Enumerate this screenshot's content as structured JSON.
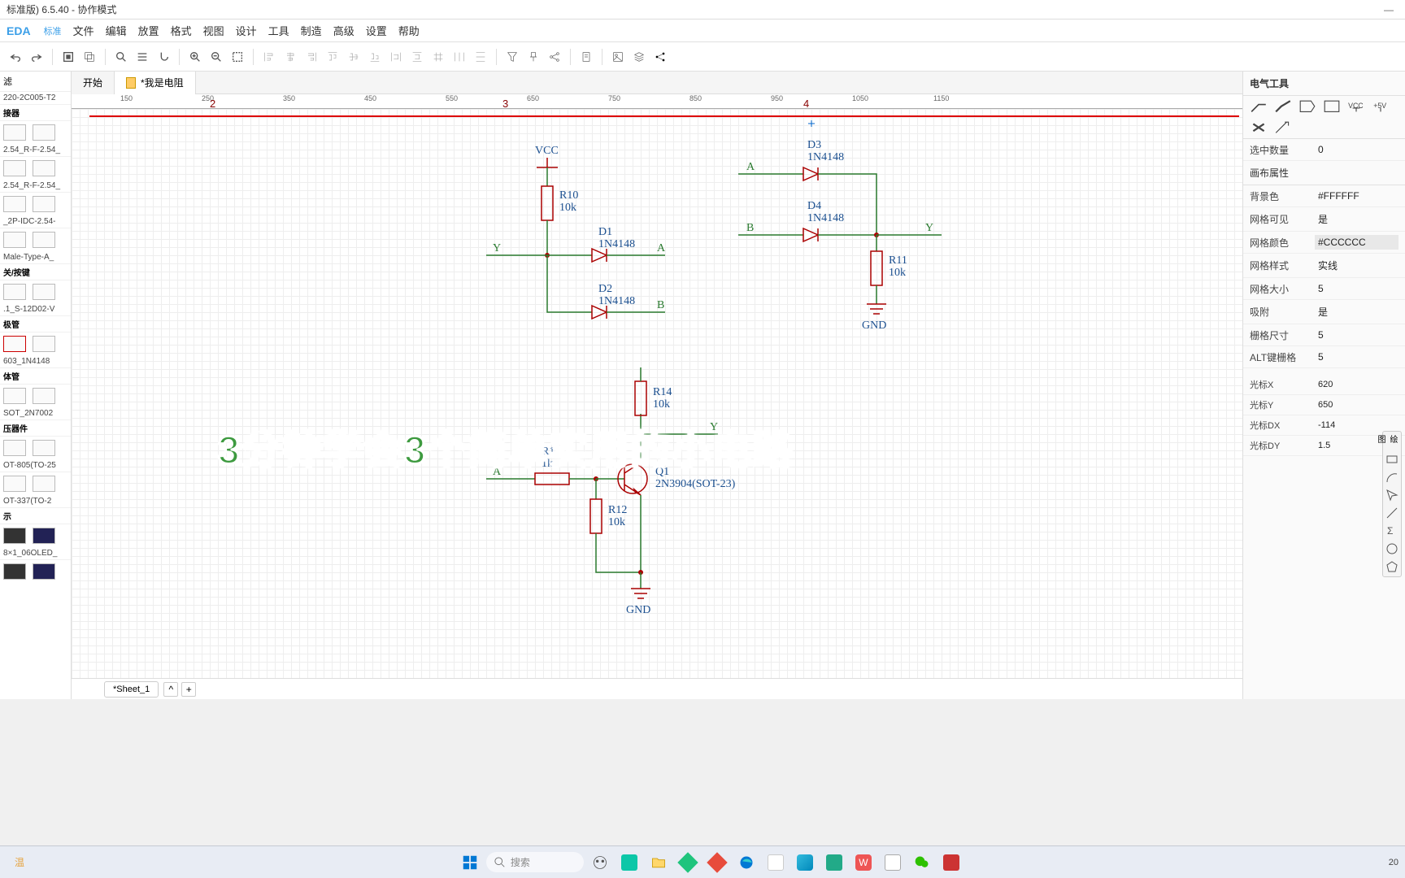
{
  "title": "标准版) 6.5.40 - 协作模式",
  "logo": "EDA",
  "logo_sub": "标准",
  "menus": [
    "文件",
    "编辑",
    "放置",
    "格式",
    "视图",
    "设计",
    "工具",
    "制造",
    "高级",
    "设置",
    "帮助"
  ],
  "tabs": {
    "start": "开始",
    "file": "*我是电阻"
  },
  "ruler_marks": [
    "150",
    "250",
    "350",
    "450",
    "550",
    "650",
    "750",
    "850",
    "950",
    "1050",
    "1150"
  ],
  "ruler_big": [
    "2",
    "3",
    "4"
  ],
  "left": {
    "filter": "滤",
    "cat1": "接器",
    "items": [
      "220-2C005-T2",
      "2.54_R-F-2.54_",
      "2.54_R-F-2.54_",
      "_2P-IDC-2.54-",
      "Male-Type-A_",
      "关/按键",
      ".1_S-12D02-V",
      "极管",
      "603_1N4148",
      "体管",
      "SOT_2N7002",
      "压器件",
      "OT-805(TO-25",
      "OT-337(TO-2",
      "示",
      "8×1_06OLED_"
    ]
  },
  "sheet_tab": "*Sheet_1",
  "right": {
    "title": "电气工具",
    "sel_count_label": "选中数量",
    "sel_count": "0",
    "canvas_section": "画布属性",
    "props": [
      {
        "label": "背景色",
        "val": "#FFFFFF"
      },
      {
        "label": "网格可见",
        "val": "是"
      },
      {
        "label": "网格颜色",
        "val": "#CCCCCC",
        "hl": true
      },
      {
        "label": "网格样式",
        "val": "实线"
      },
      {
        "label": "网格大小",
        "val": "5"
      },
      {
        "label": "吸附",
        "val": "是"
      },
      {
        "label": "栅格尺寸",
        "val": "5"
      },
      {
        "label": "ALT键栅格",
        "val": "5"
      }
    ],
    "cursor": [
      {
        "label": "光标X",
        "val": "620"
      },
      {
        "label": "光标Y",
        "val": "650"
      },
      {
        "label": "光标DX",
        "val": "-114"
      },
      {
        "label": "光标DY",
        "val": "1.5"
      }
    ]
  },
  "floating_title": "绘图",
  "sch": {
    "vcc": "VCC",
    "gnd1": "GND",
    "gnd2": "GND",
    "r10": {
      "name": "R10",
      "val": "10k"
    },
    "r11": {
      "name": "R11",
      "val": "10k"
    },
    "r12": {
      "name": "R12",
      "val": "10k"
    },
    "r13": {
      "name": "R13",
      "val": "1k"
    },
    "r14": {
      "name": "R14",
      "val": "10k"
    },
    "d1": {
      "name": "D1",
      "val": "1N4148"
    },
    "d2": {
      "name": "D2",
      "val": "1N4148"
    },
    "d3": {
      "name": "D3",
      "val": "1N4148"
    },
    "d4": {
      "name": "D4",
      "val": "1N4148"
    },
    "q1": {
      "name": "Q1",
      "val": "2N3904(SOT-23)"
    },
    "nets": {
      "A": "A",
      "B": "B",
      "Y": "Y"
    }
  },
  "overlay": "3分钟学会3个简单实用的小电路",
  "taskbar": {
    "search_placeholder": "搜索",
    "weather": "温"
  }
}
